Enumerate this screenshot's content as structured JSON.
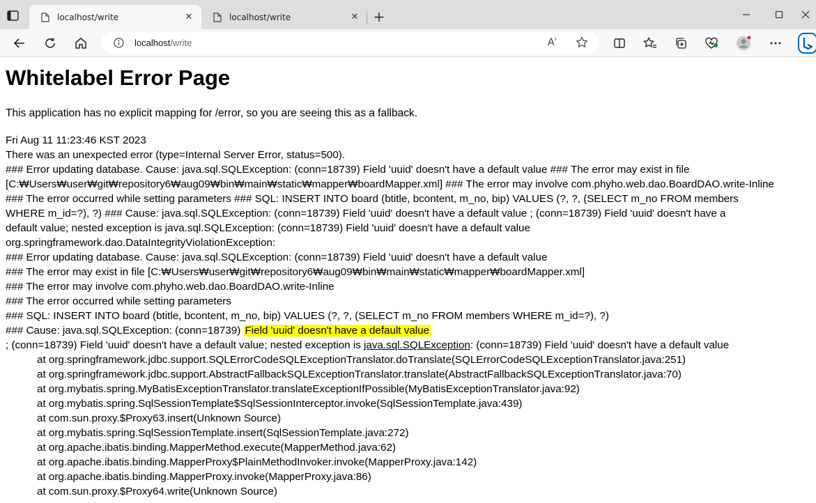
{
  "browser": {
    "tabs": [
      {
        "title": "localhost/write",
        "active": true
      },
      {
        "title": "localhost/write",
        "active": false
      }
    ],
    "address": {
      "host": "localhost",
      "path": "/write"
    },
    "read_aloud_label": "Aʾ"
  },
  "page": {
    "title": "Whitelabel Error Page",
    "fallback": "This application has no explicit mapping for /error, so you are seeing this as a fallback.",
    "timestamp": "Fri Aug 11 11:23:46 KST 2023",
    "summary": "There was an unexpected error (type=Internal Server Error, status=500).",
    "message_lines": [
      "### Error updating database. Cause: java.sql.SQLException: (conn=18739) Field 'uuid' doesn't have a default value ### The error may exist in file",
      "[C:₩Users₩user₩git₩repository6₩aug09₩bin₩main₩static₩mapper₩boardMapper.xml] ### The error may involve com.phyho.web.dao.BoardDAO.write-Inline",
      "### The error occurred while setting parameters ### SQL: INSERT INTO board (btitle, bcontent, m_no, bip) VALUES (?, ?, (SELECT m_no FROM members",
      "WHERE m_id=?), ?) ### Cause: java.sql.SQLException: (conn=18739) Field 'uuid' doesn't have a default value ; (conn=18739) Field 'uuid' doesn't have a",
      "default value; nested exception is java.sql.SQLException: (conn=18739) Field 'uuid' doesn't have a default value",
      "org.springframework.dao.DataIntegrityViolationException:",
      "### Error updating database.  Cause: java.sql.SQLException: (conn=18739) Field 'uuid' doesn't have a default value",
      "### The error may exist in file [C:₩Users₩user₩git₩repository6₩aug09₩bin₩main₩static₩mapper₩boardMapper.xml]",
      "### The error may involve com.phyho.web.dao.BoardDAO.write-Inline",
      "### The error occurred while setting parameters",
      "### SQL: INSERT INTO board (btitle, bcontent, m_no, bip)    VALUES (?, ?, (SELECT m_no FROM members WHERE m_id=?), ?)"
    ],
    "cause_prefix": "### Cause: java.sql.SQLException: (conn=18739)",
    "cause_highlight": "Field 'uuid' doesn't have a default value",
    "nested_line_a": "; (conn=18739) Field 'uuid' doesn't have a default value; nested exception is ",
    "nested_line_b": "java.sql.SQLException",
    "nested_line_c": ": (conn=18739) Field 'uuid' doesn't have a default value",
    "stack_trace": [
      "at org.springframework.jdbc.support.SQLErrorCodeSQLExceptionTranslator.doTranslate(SQLErrorCodeSQLExceptionTranslator.java:251)",
      "at org.springframework.jdbc.support.AbstractFallbackSQLExceptionTranslator.translate(AbstractFallbackSQLExceptionTranslator.java:70)",
      "at org.mybatis.spring.MyBatisExceptionTranslator.translateExceptionIfPossible(MyBatisExceptionTranslator.java:92)",
      "at org.mybatis.spring.SqlSessionTemplate$SqlSessionInterceptor.invoke(SqlSessionTemplate.java:439)",
      "at com.sun.proxy.$Proxy63.insert(Unknown Source)",
      "at org.mybatis.spring.SqlSessionTemplate.insert(SqlSessionTemplate.java:272)",
      "at org.apache.ibatis.binding.MapperMethod.execute(MapperMethod.java:62)",
      "at org.apache.ibatis.binding.MapperProxy$PlainMethodInvoker.invoke(MapperProxy.java:142)",
      "at org.apache.ibatis.binding.MapperProxy.invoke(MapperProxy.java:86)",
      "at com.sun.proxy.$Proxy64.write(Unknown Source)"
    ]
  },
  "colors": {
    "highlight": "#ffff00",
    "accent": "#0067c0"
  }
}
